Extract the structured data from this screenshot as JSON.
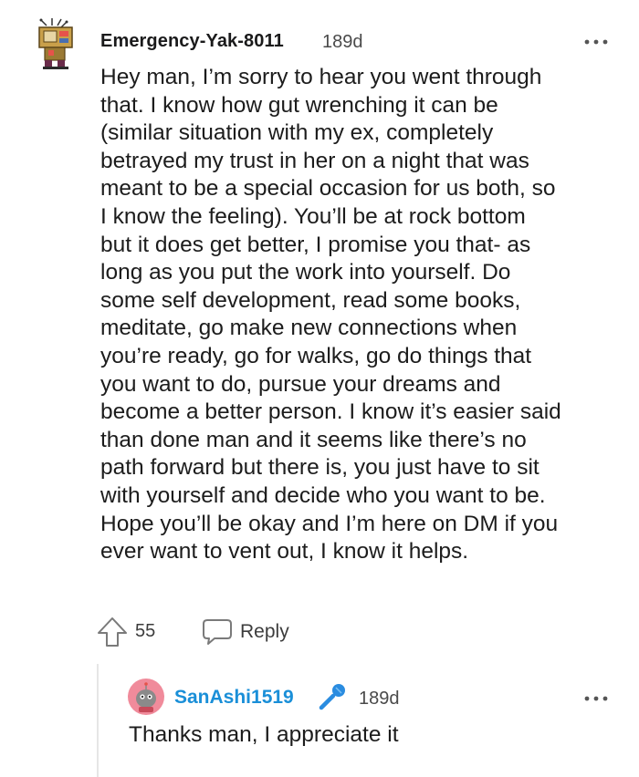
{
  "comment": {
    "author": "Emergency-Yak-8011",
    "timestamp": "189d",
    "avatar_icon": "pixel-art-avatar-icon",
    "body_lines": [
      "Hey man, I’m sorry to hear you went through",
      "that. I know how gut wrenching it can be",
      "(similar situation with my ex, completely",
      "betrayed my trust in her on a night that was",
      "meant to be a special occasion for us both, so",
      "I know the feeling). You’ll be at rock bottom",
      "but it does get better, I promise you that- as",
      "long as you put the work into yourself. Do",
      "some self development, read some books,",
      "meditate, go make new connections when",
      "you’re ready, go for walks, go do things that",
      "you want to do, pursue your dreams and",
      "become a better person. I know it’s easier said",
      "than done man and it seems like there’s no",
      "path forward but there is, you just have to sit",
      "with yourself and decide who you want to be.",
      "Hope you’ll be okay and I’m here on DM if you",
      "ever want to vent out, I know it helps."
    ],
    "votes": "55",
    "reply_label": "Reply"
  },
  "reply": {
    "author": "SanAshi1519",
    "author_color": "#1a8fd8",
    "timestamp": "189d",
    "flair_icon": "microphone-icon",
    "body": "Thanks man, I appreciate it"
  },
  "colors": {
    "text": "#1c1c1c",
    "muted": "#4a4a4a",
    "accent_blue": "#1a8fd8",
    "avatar_pink": "#f08b9b"
  }
}
